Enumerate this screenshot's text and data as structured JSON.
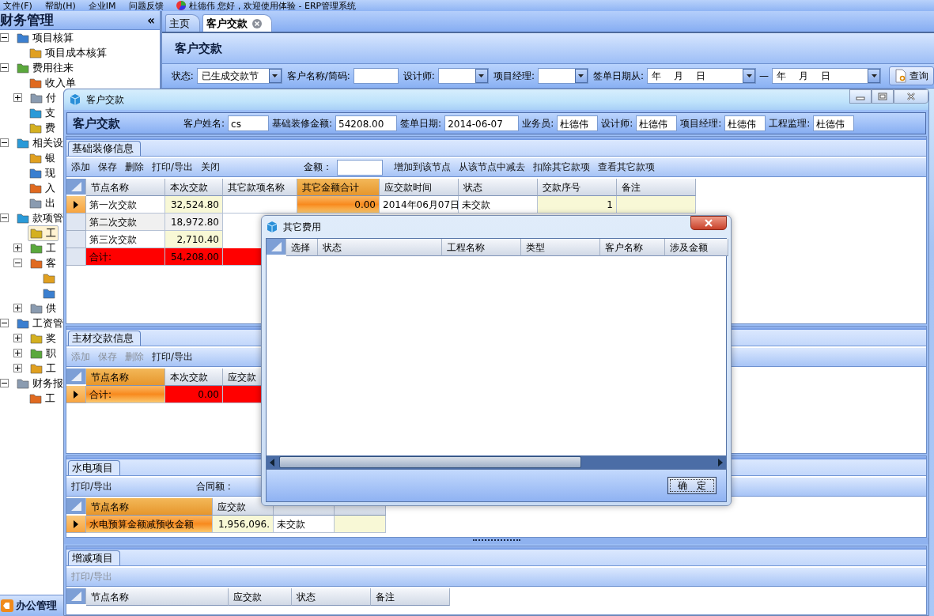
{
  "menu_bar": {
    "items": [
      "文件(F)",
      "帮助(H)",
      "企业IM",
      "问题反馈"
    ],
    "greeting": "杜德伟 您好，欢迎使用体验 - ERP管理系统"
  },
  "sidebar": {
    "title": "财务管理",
    "collapse": "«",
    "tree": [
      {
        "label": "项目核算",
        "expanded": true,
        "selected": false,
        "children": [
          {
            "label": "项目成本核算",
            "selected": false
          }
        ]
      },
      {
        "label": "费用往来",
        "expanded": true,
        "selected": false,
        "children": [
          {
            "label": "收入单",
            "selected": false
          },
          {
            "label": "付",
            "expanded": false,
            "selected": false
          },
          {
            "label": "支",
            "selected": false
          },
          {
            "label": "费",
            "selected": false
          }
        ]
      },
      {
        "label": "相关设",
        "expanded": true,
        "selected": false,
        "children": [
          {
            "label": "银",
            "selected": false
          },
          {
            "label": "现",
            "selected": false
          },
          {
            "label": "入",
            "selected": false
          },
          {
            "label": "出",
            "selected": false
          }
        ]
      },
      {
        "label": "款项管",
        "expanded": true,
        "selected": false,
        "children": [
          {
            "label": "工",
            "selected": true
          },
          {
            "label": "工",
            "expanded": false,
            "selected": false
          },
          {
            "label": "客",
            "expanded": true,
            "selected": false,
            "children": [
              {
                "selected": false
              },
              {
                "selected": false
              }
            ]
          },
          {
            "label": "供",
            "expanded": false,
            "selected": false
          }
        ]
      },
      {
        "label": "工资管",
        "expanded": true,
        "selected": false,
        "children": [
          {
            "label": "奖",
            "expanded": false,
            "selected": false
          },
          {
            "label": "职",
            "expanded": false,
            "selected": false
          },
          {
            "label": "工",
            "expanded": false,
            "selected": false
          }
        ]
      },
      {
        "label": "财务报",
        "expanded": true,
        "selected": false,
        "children": [
          {
            "label": "工",
            "selected": false
          }
        ]
      }
    ],
    "bottom_button": "办公管理"
  },
  "tabs": [
    {
      "label": "主页",
      "selected": false,
      "closable": false
    },
    {
      "label": "客户交款",
      "selected": true,
      "closable": true
    }
  ],
  "page": {
    "title": "客户交款",
    "filters": [
      {
        "kind": "combo",
        "label": "状态:",
        "value": "已生成交款节"
      },
      {
        "kind": "text",
        "label": "客户名称/简码:"
      },
      {
        "kind": "combo",
        "label": "设计师:"
      },
      {
        "kind": "combo",
        "label": "项目经理:"
      },
      {
        "kind": "daterange",
        "label": "签单日期从:",
        "from": "年　 月　 日",
        "separator": "—",
        "to": "年　 月　 日"
      }
    ],
    "search_button": "查询"
  },
  "child_window": {
    "title": "客户交款",
    "header": {
      "title": "客户交款",
      "fields": [
        {
          "label": "客户姓名:",
          "value": "cs"
        },
        {
          "label": "基础装修金额:",
          "value": "54208.00"
        },
        {
          "label": "签单日期:",
          "value": "2014-06-07"
        },
        {
          "label": "业务员:",
          "value": "杜德伟"
        },
        {
          "label": "设计师:",
          "value": "杜德伟"
        },
        {
          "label": "项目经理:",
          "value": "杜德伟"
        },
        {
          "label": "工程监理:",
          "value": "杜德伟"
        }
      ]
    },
    "sections": [
      {
        "title": "基础装修信息",
        "toolbar": [
          {
            "kind": "button",
            "label": "添加",
            "disabled": false
          },
          {
            "kind": "button",
            "label": "保存",
            "disabled": false
          },
          {
            "kind": "button",
            "label": "删除",
            "disabled": false
          },
          {
            "kind": "button",
            "label": "打印/导出",
            "disabled": false
          },
          {
            "kind": "button",
            "label": "关闭",
            "disabled": false
          },
          {
            "kind": "label",
            "label": "金额："
          },
          {
            "kind": "field"
          },
          {
            "kind": "button",
            "label": "增加到该节点",
            "disabled": false
          },
          {
            "kind": "button",
            "label": "从该节点中减去",
            "disabled": false
          },
          {
            "kind": "button",
            "label": "扣除其它款项",
            "disabled": false
          },
          {
            "kind": "button",
            "label": "查看其它款项",
            "disabled": false
          }
        ],
        "grid": {
          "columns": [
            {
              "label": "节点名称",
              "highlight": false
            },
            {
              "label": "本次交款",
              "highlight": false,
              "numeric": true,
              "editable": true
            },
            {
              "label": "其它款项名称",
              "highlight": false
            },
            {
              "label": "其它金额合计",
              "highlight": true,
              "numeric": true
            },
            {
              "label": "应交款时间",
              "highlight": false
            },
            {
              "label": "状态",
              "highlight": false
            },
            {
              "label": "交款序号",
              "highlight": false,
              "numeric": true,
              "editable": true
            },
            {
              "label": "备注",
              "highlight": false,
              "editable": true
            }
          ],
          "rows": [
            {
              "kind": "normal",
              "current": true,
              "cells": [
                "第一次交款",
                "32,524.80",
                null,
                "0.00",
                "2014年06月07日",
                "未交款",
                "1",
                null
              ]
            },
            {
              "kind": "normal",
              "current": false,
              "cells": [
                "第二次交款",
                "18,972.80"
              ]
            },
            {
              "kind": "normal",
              "current": false,
              "cells": [
                "第三次交款",
                "2,710.40"
              ]
            },
            {
              "kind": "total",
              "current": false,
              "cells": [
                "合计:",
                "54,208.00",
                null
              ]
            }
          ]
        }
      },
      {
        "title": "主材交款信息",
        "toolbar": [
          {
            "kind": "button",
            "label": "添加",
            "disabled": true
          },
          {
            "kind": "button",
            "label": "保存",
            "disabled": true
          },
          {
            "kind": "button",
            "label": "删除",
            "disabled": true
          },
          {
            "kind": "button",
            "label": "打印/导出",
            "disabled": false
          }
        ],
        "grid": {
          "columns": [
            {
              "label": "节点名称",
              "highlight": true
            },
            {
              "label": "本次交款",
              "highlight": false,
              "numeric": true
            },
            {
              "label": "应交款",
              "highlight": false
            }
          ],
          "rows": [
            {
              "kind": "total",
              "current": true,
              "cells": [
                "合计:",
                "0.00",
                null
              ]
            }
          ]
        }
      },
      {
        "title": "水电项目",
        "toolbar": [
          {
            "kind": "button",
            "label": "打印/导出",
            "disabled": false
          },
          {
            "kind": "label",
            "label": "合同额 :"
          }
        ],
        "grid": {
          "columns": [
            {
              "label": "节点名称",
              "highlight": true
            },
            {
              "label": "应交款",
              "highlight": false,
              "numeric": true,
              "editable": true
            },
            {
              "highlight": false
            },
            {
              "highlight": false,
              "editable": true
            }
          ],
          "rows": [
            {
              "kind": "normal",
              "current": true,
              "cells": [
                "水电预算金额减预收金额",
                "1,956,096.",
                "未交款",
                null
              ]
            }
          ]
        }
      },
      {
        "title": "增减项目",
        "toolbar": [
          {
            "kind": "button",
            "label": "打印/导出",
            "disabled": true
          }
        ],
        "grid": {
          "columns": [
            {
              "label": "节点名称",
              "highlight": false
            },
            {
              "label": "应交款",
              "highlight": false
            },
            {
              "label": "状态",
              "highlight": false
            },
            {
              "label": "备注",
              "highlight": false
            }
          ]
        }
      }
    ]
  },
  "dialog": {
    "title": "其它费用",
    "columns": [
      "选择",
      "状态",
      "工程名称",
      "类型",
      "客户名称",
      "涉及金额"
    ],
    "ok_button": "确　定"
  }
}
